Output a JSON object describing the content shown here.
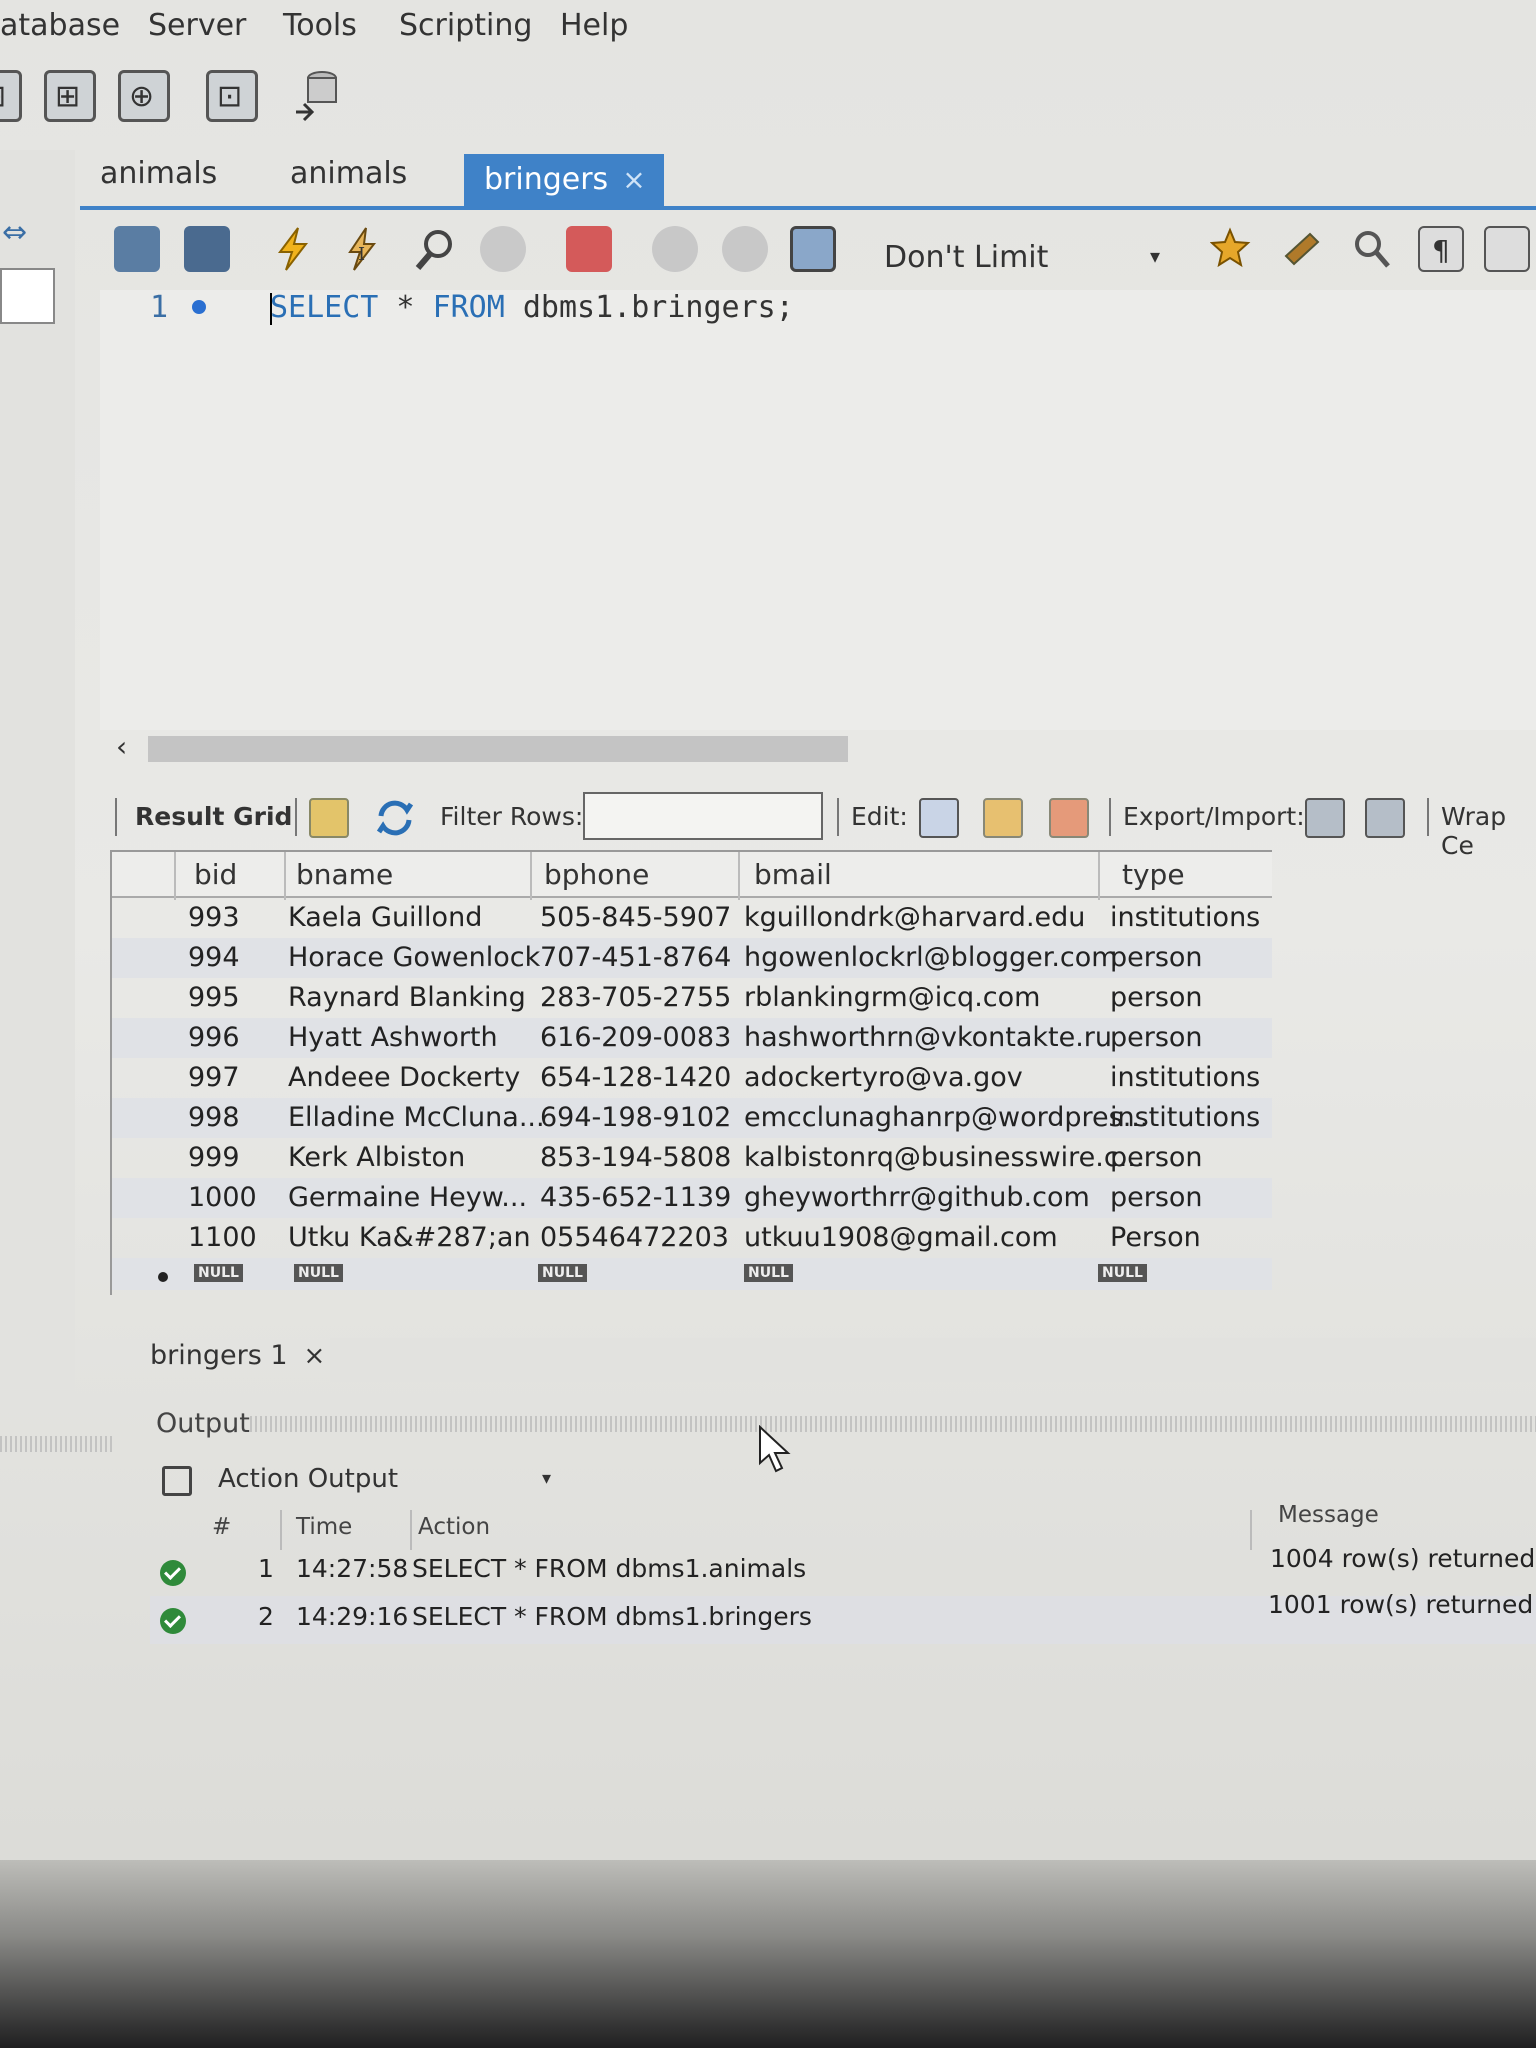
{
  "menu": [
    "atabase",
    "Server",
    "Tools",
    "Scripting",
    "Help"
  ],
  "editor_tabs": [
    {
      "label": "animals",
      "active": false
    },
    {
      "label": "animals",
      "active": false
    },
    {
      "label": "bringers",
      "active": true,
      "close": "×"
    }
  ],
  "sql_toolbar": {
    "limit_label": "Don't Limit",
    "limit_caret": "▾"
  },
  "editor": {
    "line_number": "1",
    "sql_keyword_1": "SELECT",
    "sql_star": " * ",
    "sql_keyword_2": "FROM",
    "sql_rest": " dbms1.bringers;"
  },
  "result_toolbar": {
    "result_grid": "Result Grid",
    "filter_rows": "Filter Rows:",
    "edit": "Edit:",
    "export_import": "Export/Import:",
    "wrap": "Wrap Ce"
  },
  "grid": {
    "columns": [
      "bid",
      "bname",
      "bphone",
      "bmail",
      "type"
    ],
    "rows": [
      [
        "993",
        "Kaela Guillond",
        "505-845-5907",
        "kguillondrk@harvard.edu",
        "institutions"
      ],
      [
        "994",
        "Horace Gowenlock",
        "707-451-8764",
        "hgowenlockrl@blogger.com",
        "person"
      ],
      [
        "995",
        "Raynard Blanking",
        "283-705-2755",
        "rblankingrm@icq.com",
        "person"
      ],
      [
        "996",
        "Hyatt Ashworth",
        "616-209-0083",
        "hashworthrn@vkontakte.ru",
        "person"
      ],
      [
        "997",
        "Andeee Dockerty",
        "654-128-1420",
        "adockertyro@va.gov",
        "institutions"
      ],
      [
        "998",
        "Elladine McCluna...",
        "694-198-9102",
        "emcclunaghanrp@wordpres...",
        "institutions"
      ],
      [
        "999",
        "Kerk Albiston",
        "853-194-5808",
        "kalbistonrq@businesswire.c...",
        "person"
      ],
      [
        "1000",
        "Germaine Heyw...",
        "435-652-1139",
        "gheyworthrr@github.com",
        "person"
      ],
      [
        "1100",
        "Utku Ka&#287;an",
        "05546472203",
        "utkuu1908@gmail.com",
        "Person"
      ]
    ],
    "null_label": "NULL"
  },
  "result_tab": {
    "label": "bringers 1",
    "close": "×"
  },
  "output": {
    "label": "Output",
    "selector": "Action Output",
    "caret": "▾",
    "columns": {
      "num": "#",
      "time": "Time",
      "action": "Action",
      "message": "Message"
    },
    "rows": [
      {
        "num": "1",
        "time": "14:27:58",
        "action": "SELECT * FROM dbms1.animals",
        "message": "1004 row(s) returned"
      },
      {
        "num": "2",
        "time": "14:29:16",
        "action": "SELECT * FROM dbms1.bringers",
        "message": "1001 row(s) returned"
      }
    ]
  },
  "colors": {
    "accent": "#3f82c8",
    "ok": "#2f8a3a",
    "keyword": "#2a6fb5"
  }
}
